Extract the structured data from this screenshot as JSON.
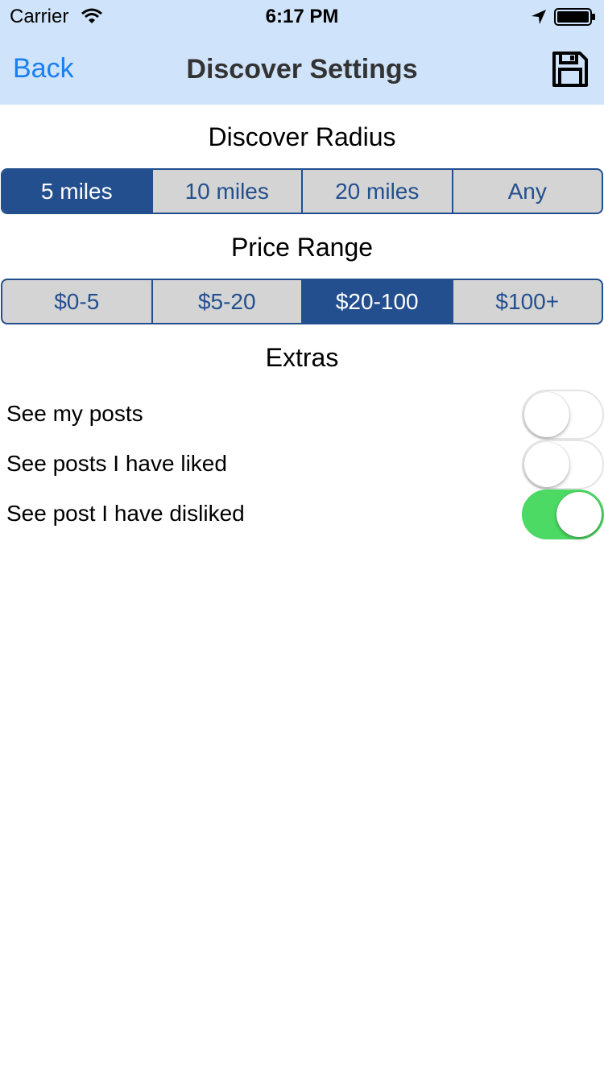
{
  "status_bar": {
    "carrier": "Carrier",
    "time": "6:17 PM"
  },
  "nav": {
    "back_label": "Back",
    "title": "Discover Settings",
    "save_icon": "floppy-disk-icon"
  },
  "radius": {
    "title": "Discover Radius",
    "options": [
      "5 miles",
      "10 miles",
      "20 miles",
      "Any"
    ],
    "selected": "5 miles"
  },
  "price": {
    "title": "Price Range",
    "options": [
      "$0-5",
      "$5-20",
      "$20-100",
      "$100+"
    ],
    "selected": "$20-100"
  },
  "extras": {
    "title": "Extras",
    "items": [
      {
        "label": "See my posts",
        "on": false
      },
      {
        "label": "See posts I have liked",
        "on": false
      },
      {
        "label": "See post I have disliked",
        "on": true
      }
    ]
  },
  "colors": {
    "nav_background": "#cfe3fa",
    "accent": "#234f8e",
    "link": "#1a7ff0",
    "switch_on": "#4cd964"
  }
}
